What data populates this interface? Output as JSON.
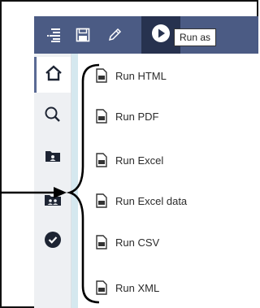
{
  "toolbar": {
    "tooltip": "Run as",
    "icons": [
      "toc-menu-icon",
      "save-icon",
      "pencil-icon",
      "play-icon"
    ]
  },
  "sidebar": {
    "items": [
      "home-icon",
      "search-icon",
      "folder-icon",
      "team-folder-icon",
      "recent-icon"
    ]
  },
  "menu": {
    "items": [
      {
        "label": "Run HTML"
      },
      {
        "label": "Run PDF"
      },
      {
        "label": "Run Excel"
      },
      {
        "label": "Run Excel data"
      },
      {
        "label": "Run CSV"
      },
      {
        "label": "Run XML"
      }
    ]
  },
  "colors": {
    "toolbar_bg": "#4b5b84",
    "run_button_bg": "#27324f",
    "sidebar_bg": "#eef0f3"
  }
}
